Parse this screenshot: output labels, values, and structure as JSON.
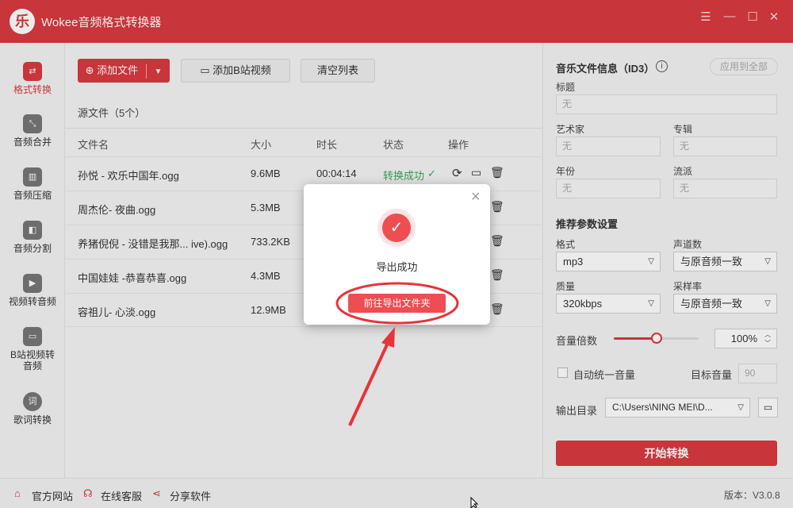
{
  "app": {
    "title": "Wokee音频格式转换器",
    "logo": "乐"
  },
  "window_controls": {
    "menu": "☰",
    "minimize": "—",
    "maximize": "☐",
    "close": "✕"
  },
  "sidebar": {
    "items": [
      {
        "label": "格式转换",
        "icon": "format-convert-icon",
        "glyph": "⇄"
      },
      {
        "label": "音频合并",
        "icon": "merge-icon",
        "glyph": "⤡"
      },
      {
        "label": "音频压缩",
        "icon": "compress-icon",
        "glyph": "▥"
      },
      {
        "label": "音频分割",
        "icon": "split-icon",
        "glyph": "◧"
      },
      {
        "label": "视频转音频",
        "icon": "video-icon",
        "glyph": "▶"
      },
      {
        "label": "B站视频转音频",
        "icon": "bilibili-icon",
        "glyph": "▭"
      },
      {
        "label": "歌词转换",
        "icon": "lyrics-icon",
        "glyph": "词"
      }
    ]
  },
  "toolbar": {
    "add_file": "添加文件",
    "add_bilibili": "添加B站视频",
    "clear_list": "清空列表"
  },
  "source": {
    "label": "源文件（5个）"
  },
  "table": {
    "headers": [
      "文件名",
      "大小",
      "时长",
      "状态",
      "操作"
    ],
    "rows": [
      {
        "name": "孙悦 - 欢乐中国年.ogg",
        "size": "9.6MB",
        "duration": "00:04:14",
        "status": "转换成功"
      },
      {
        "name": "周杰伦- 夜曲.ogg",
        "size": "5.3MB"
      },
      {
        "name": "养猪倪倪 - 没错是我那...   ive).ogg",
        "size": "733.2KB"
      },
      {
        "name": "中国娃娃 -恭喜恭喜.ogg",
        "size": "4.3MB"
      },
      {
        "name": "容祖儿- 心淡.ogg",
        "size": "12.9MB"
      }
    ]
  },
  "id3": {
    "title": "音乐文件信息（ID3）",
    "apply_all": "应用到全部",
    "fields": {
      "title_label": "标题",
      "artist_label": "艺术家",
      "album_label": "专辑",
      "year_label": "年份",
      "genre_label": "流派",
      "placeholder": "无"
    }
  },
  "params": {
    "title": "推荐参数设置",
    "format_label": "格式",
    "format_value": "mp3",
    "channel_label": "声道数",
    "channel_value": "与原音频一致",
    "quality_label": "质量",
    "quality_value": "320kbps",
    "samplerate_label": "采样率",
    "samplerate_value": "与原音频一致",
    "volume_label": "音量倍数",
    "volume_value": "100%",
    "volume_level": 0.5,
    "auto_volume_label": "自动统一音量",
    "target_volume_label": "目标音量",
    "target_volume_value": "90",
    "output_label": "输出目录",
    "output_value": "C:\\Users\\NING MEI\\D...",
    "start_button": "开始转换"
  },
  "footer": {
    "website": "官方网站",
    "support": "在线客服",
    "share": "分享软件",
    "version": "版本：V3.0.8"
  },
  "modal": {
    "message": "导出成功",
    "button": "前往导出文件夹",
    "close": "×"
  },
  "colors": {
    "accent": "#d93a3f",
    "success": "#3aa858",
    "annotation": "#e8333a"
  }
}
